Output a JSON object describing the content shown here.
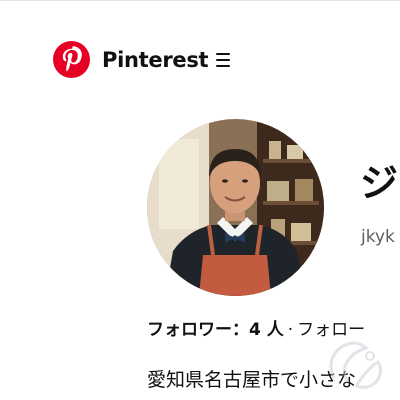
{
  "header": {
    "brand": "Pinterest",
    "brand_color": "#E60023",
    "menu_icon": "hamburger-menu-icon"
  },
  "profile": {
    "name": "ジ",
    "handle": "jkyk",
    "avatar_icon": "profile-photo-man-in-apron"
  },
  "stats": {
    "followers": "フォロワー：4 人",
    "separator": "·",
    "following": "フォロー"
  },
  "bio": "愛知県名古屋市で小さな"
}
